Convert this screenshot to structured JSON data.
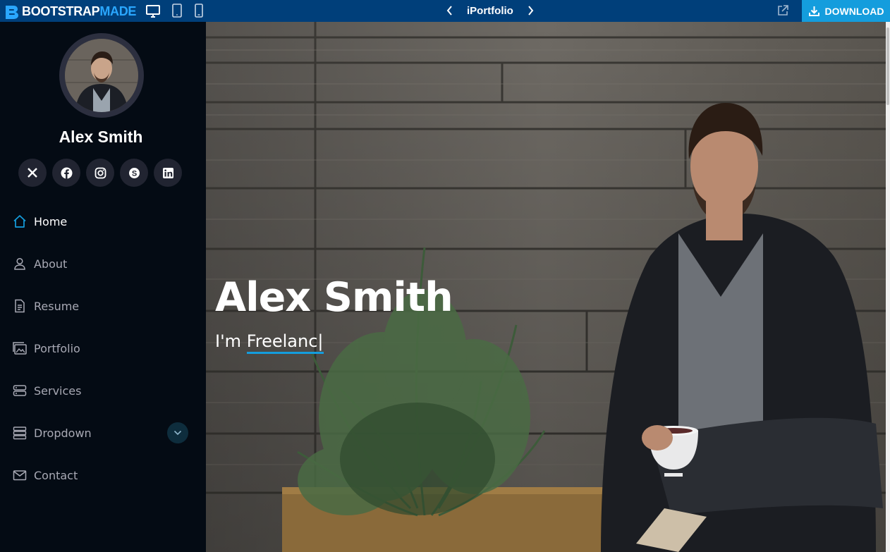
{
  "topbar": {
    "brand_primary": "BOOTSTRAP",
    "brand_secondary": "MADE",
    "device_icons": [
      "desktop-icon",
      "tablet-icon",
      "mobile-icon"
    ],
    "page_title": "iPortfolio",
    "download_label": "DOWNLOAD",
    "colors": {
      "bar": "#003f7a",
      "download": "#149ddd"
    }
  },
  "profile": {
    "name": "Alex Smith",
    "social": [
      "x-icon",
      "facebook-icon",
      "instagram-icon",
      "skype-icon",
      "linkedin-icon"
    ]
  },
  "nav": {
    "items": [
      {
        "label": "Home",
        "icon": "home-icon",
        "active": true
      },
      {
        "label": "About",
        "icon": "person-icon"
      },
      {
        "label": "Resume",
        "icon": "file-text-icon"
      },
      {
        "label": "Portfolio",
        "icon": "images-icon"
      },
      {
        "label": "Services",
        "icon": "server-icon"
      },
      {
        "label": "Dropdown",
        "icon": "menu-icon",
        "has_children": true
      },
      {
        "label": "Contact",
        "icon": "envelope-icon"
      }
    ]
  },
  "hero": {
    "title": "Alex Smith",
    "subtitle_prefix": "I'm",
    "typed_text": "Freelanc",
    "cursor": "|",
    "accent": "#149ddd"
  }
}
